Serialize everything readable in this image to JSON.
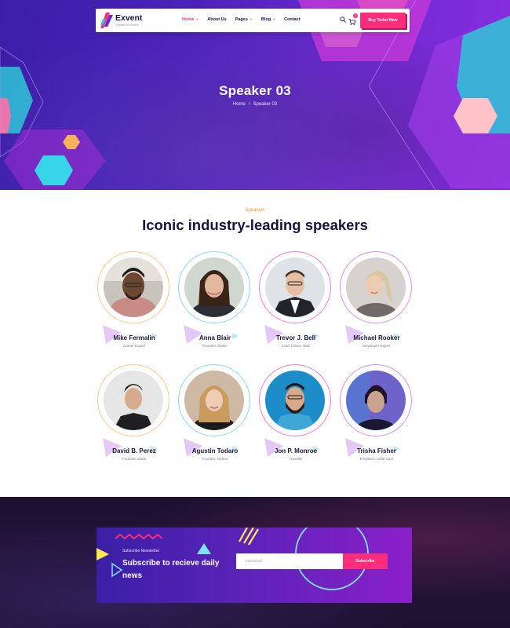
{
  "brand": {
    "name": "Exvent",
    "tagline": "Theme for Event"
  },
  "nav": {
    "items": [
      {
        "label": "Home",
        "active": true,
        "has_dropdown": true
      },
      {
        "label": "About Us",
        "active": false,
        "has_dropdown": false
      },
      {
        "label": "Pages",
        "active": false,
        "has_dropdown": true
      },
      {
        "label": "Blog",
        "active": false,
        "has_dropdown": true
      },
      {
        "label": "Contact",
        "active": false,
        "has_dropdown": false
      }
    ],
    "search_icon": "search-icon",
    "cart_icon": "cart-icon",
    "cart_count": "0",
    "cta_label": "Buy Ticket Now"
  },
  "hero": {
    "title": "Speaker 03",
    "breadcrumb": {
      "home": "Home",
      "separator": "/",
      "current": "Speaker 03"
    }
  },
  "speakers_section": {
    "eyebrow": "Speakers",
    "title": "Iconic industry-leading speakers",
    "speakers": [
      {
        "name": "Mike Fermalin",
        "role": "Career Expert"
      },
      {
        "name": "Anna Blair",
        "role": "Founder, Marks"
      },
      {
        "name": "Trevor J. Bell",
        "role": "Lead Trainer, Bttls"
      },
      {
        "name": "Michael Rooker",
        "role": "Developer Expert"
      },
      {
        "name": "David B. Perez",
        "role": "Founder, Mods"
      },
      {
        "name": "Agustin Todaro",
        "role": "Founder, Nickho"
      },
      {
        "name": "Jon P. Monroe",
        "role": "Traveller"
      },
      {
        "name": "Trisha Fisher",
        "role": "President, Child Care"
      }
    ]
  },
  "newsletter": {
    "eyebrow": "Subscribe Newsletter",
    "title": "Subscribe to recieve daily news",
    "input_placeholder": "Your Email",
    "button_label": "Subscribe"
  },
  "colors": {
    "accent": "#ff2d7a",
    "heading": "#1c1240",
    "eyebrow": "#ff9a2e",
    "hero_start": "#3b1ea8",
    "hero_end": "#8a2ee0"
  }
}
